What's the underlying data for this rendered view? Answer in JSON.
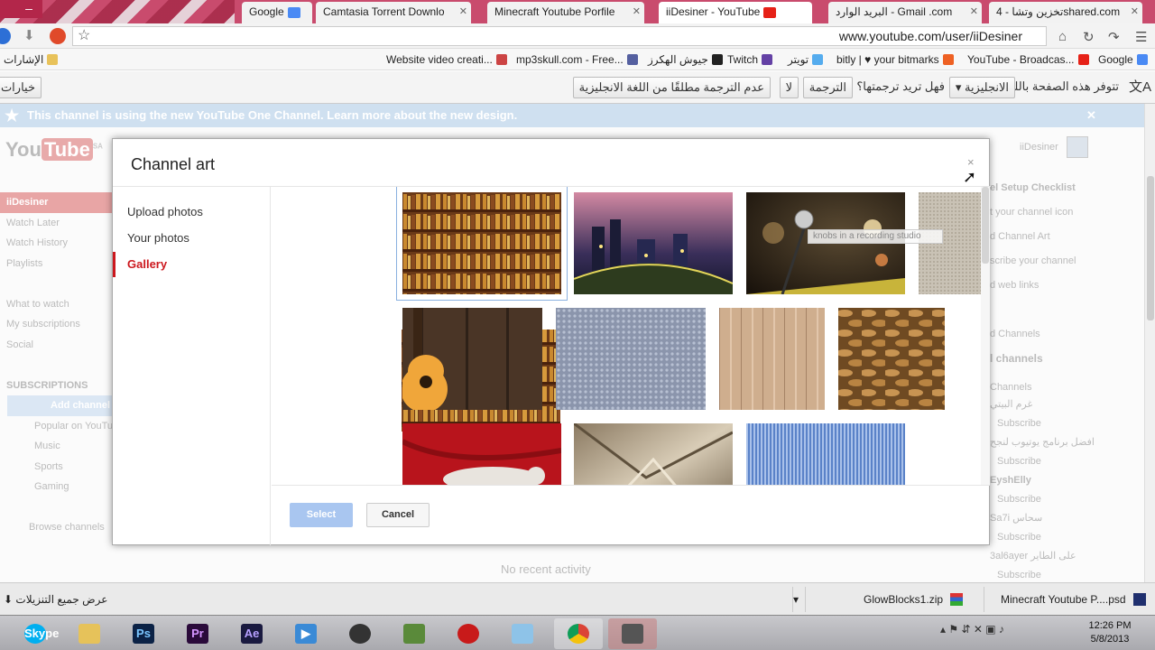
{
  "browser": {
    "window_controls": [
      "–",
      "□"
    ],
    "tabs": [
      {
        "label": "Google",
        "active": false
      },
      {
        "label": "Camtasia Torrent Downlo",
        "active": false
      },
      {
        "label": "Minecraft Youtube Porfile",
        "active": false
      },
      {
        "label": "iiDesiner - YouTube",
        "active": true
      },
      {
        "label": "البريد الوارد - Gmail .com",
        "active": false
      },
      {
        "label": "تخزين وتشا - 4shared.com",
        "active": false
      }
    ],
    "url": "www.youtube.com/user/iiDesiner",
    "bookmarks": [
      {
        "label": "الإشارات"
      },
      {
        "label": "Website video creati..."
      },
      {
        "label": "mp3skull.com - Free..."
      },
      {
        "label": "جيوش الهكرز"
      },
      {
        "label": "Twitch"
      },
      {
        "label": "تويتر"
      },
      {
        "label": "bitly | ♥ your bitmarks"
      },
      {
        "label": "YouTube - Broadcas..."
      },
      {
        "label": "Google"
      }
    ],
    "translate_bar": {
      "message": "تتوفر هذه الصفحة باللغة",
      "language": "الانجليزية",
      "question": "فهل تريد ترجمتها؟",
      "translate_btn": "الترجمة",
      "no_btn": "لا",
      "never_btn": "عدم الترجمة مطلقًا من اللغة الانجليزية",
      "options_btn": "خيارات"
    }
  },
  "youtube": {
    "notice": "This channel is using the new YouTube One Channel. Learn more about the new design.",
    "logo_you": "You",
    "logo_tube": "Tube",
    "logo_region": "SA",
    "username": "iiDesiner",
    "sidebar": [
      "iiDesiner",
      "Watch Later",
      "Watch History",
      "Playlists",
      "",
      "What to watch",
      "My subscriptions",
      "Social",
      "",
      "SUBSCRIPTIONS",
      "Add channel",
      "Popular on YouTube",
      "Music",
      "Sports",
      "Gaming",
      "",
      "Browse channels"
    ],
    "right_panel": [
      "el Setup Checklist",
      "t your channel icon",
      "d Channel Art",
      "scribe your channel",
      "d web links",
      "",
      "d Channels",
      "l channels",
      "",
      "Channels",
      "غرم البيتي",
      "Subscribe",
      "افضل برنامج يوتيوب لنجح",
      "Subscribe",
      "EyshElly",
      "Subscribe",
      "Sa7i سحاس",
      "Subscribe",
      "3al6ayer على الطاير",
      "Subscribe"
    ],
    "no_activity": "No recent activity"
  },
  "dialog": {
    "title": "Channel art",
    "close": "×",
    "nav": [
      "Upload photos",
      "Your photos",
      "Gallery"
    ],
    "selected_nav": "Gallery",
    "tooltip": "knobs in a recording studio",
    "thumbnails": [
      {
        "name": "bookshelf"
      },
      {
        "name": "city-night"
      },
      {
        "name": "microphone"
      },
      {
        "name": "recording-knobs"
      },
      {
        "name": "guitar"
      },
      {
        "name": "metal-mesh"
      },
      {
        "name": "wood-planks"
      },
      {
        "name": "woven-basket"
      },
      {
        "name": "red-blanket-cat"
      },
      {
        "name": "paper-folds"
      },
      {
        "name": "blue-ribbed"
      }
    ],
    "select_btn": "Select",
    "cancel_btn": "Cancel"
  },
  "downloads": {
    "show_all": "عرض جميع التنزيلات",
    "items": [
      {
        "label": "GlowBlocks1.zip"
      },
      {
        "label": "Minecraft Youtube P....psd"
      }
    ]
  },
  "taskbar": {
    "apps": [
      "Skype",
      "Explorer",
      "Ps",
      "Pr",
      "Ae",
      "Player",
      "Camtasia",
      "Minecraft",
      "Red",
      "Notes",
      "Chrome",
      "Tools"
    ],
    "time": "12:26 PM",
    "date": "5/8/2013"
  }
}
